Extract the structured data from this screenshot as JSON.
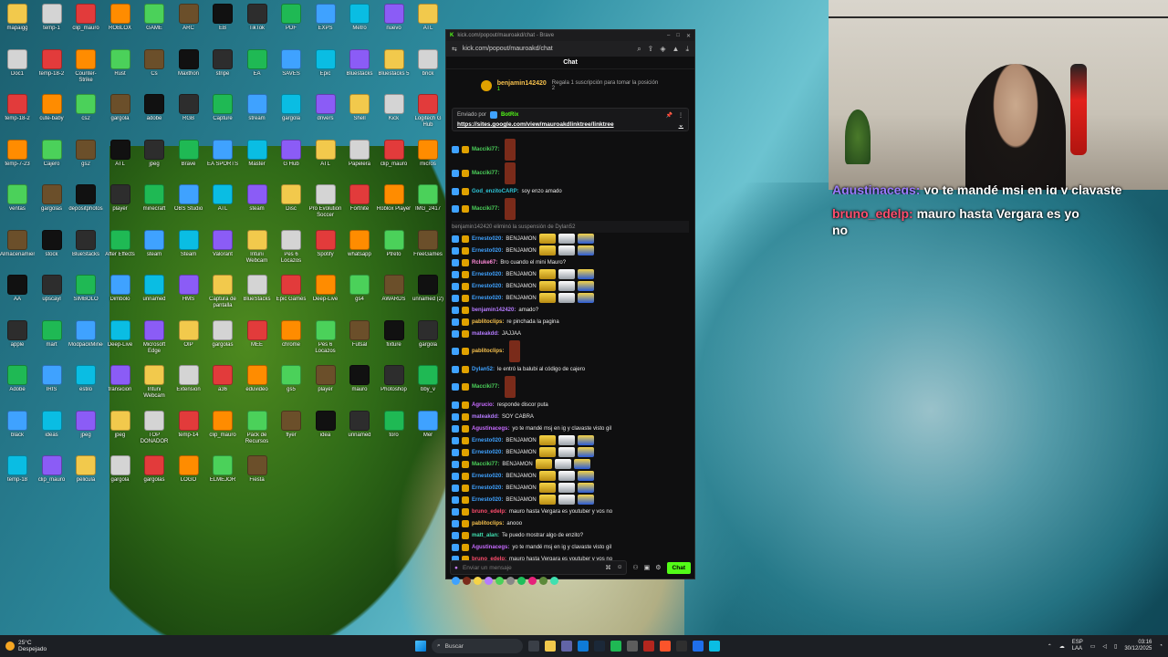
{
  "browser": {
    "title_url": "kick.com/popout/mauroakd/chat - Brave",
    "url": "kick.com/popout/mauroakd/chat"
  },
  "chat": {
    "header": "Chat",
    "top_supporter": {
      "name": "benjamin142420",
      "count": "1",
      "note": "Regala 1 suscripción para tomar la posición 2"
    },
    "pinned": {
      "label": "Enviado por",
      "sender": "BotRix",
      "link": "https://sites.google.com/view/mauroakdlinktree/linktree"
    },
    "messages": [
      {
        "user": "Macciki77:",
        "color": "#4bd15a",
        "text": "",
        "emotes": [
          "tall"
        ],
        "tall": true
      },
      {
        "user": "Macciki77:",
        "color": "#4bd15a",
        "text": "",
        "emotes": [
          "tall"
        ],
        "tall": true
      },
      {
        "user": "God_enzitoCARP:",
        "color": "#2ec4d6",
        "text": "soy enzo amado",
        "emotes": []
      },
      {
        "user": "Macciki77:",
        "color": "#4bd15a",
        "text": "",
        "emotes": [
          "tall"
        ],
        "tall": true
      },
      {
        "user": "",
        "color": "#8c8c8c",
        "text": "benjamin142420 eliminó la suspensión de Dylan52",
        "emotes": [],
        "system": true
      },
      {
        "user": "Ernesto020:",
        "color": "#3fa2ff",
        "text": "BENJAMON",
        "emotes": [
          "y",
          "w",
          "b"
        ]
      },
      {
        "user": "Ernesto020:",
        "color": "#3fa2ff",
        "text": "BENJAMON",
        "emotes": [
          "y",
          "w",
          "b"
        ]
      },
      {
        "user": "Rcluke67:",
        "color": "#ff8ad8",
        "text": "Bro cuando el mini Mauro?",
        "emotes": []
      },
      {
        "user": "Ernesto020:",
        "color": "#3fa2ff",
        "text": "BENJAMON",
        "emotes": [
          "y",
          "w",
          "b"
        ]
      },
      {
        "user": "Ernesto020:",
        "color": "#3fa2ff",
        "text": "BENJAMON",
        "emotes": [
          "y",
          "w",
          "b"
        ]
      },
      {
        "user": "Ernesto020:",
        "color": "#3fa2ff",
        "text": "BENJAMON",
        "emotes": [
          "y",
          "w",
          "b"
        ]
      },
      {
        "user": "benjamin142420:",
        "color": "#b57bff",
        "text": "amado?",
        "emotes": []
      },
      {
        "user": "pablitoclips:",
        "color": "#f7c14d",
        "text": "re pinchada la pagina",
        "emotes": []
      },
      {
        "user": "mateakdd:",
        "color": "#b57bff",
        "text": "JAJJAA",
        "emotes": []
      },
      {
        "user": "pablitoclips:",
        "color": "#f7c14d",
        "text": "",
        "emotes": [
          "tall"
        ],
        "tall": true
      },
      {
        "user": "Dylan52:",
        "color": "#3fa2ff",
        "text": "le entró la balubi al código de cajero",
        "emotes": []
      },
      {
        "user": "Macciki77:",
        "color": "#4bd15a",
        "text": "",
        "emotes": [
          "tall"
        ],
        "tall": true
      },
      {
        "user": "Agrucio:",
        "color": "#c76bff",
        "text": "responde discor puta",
        "emotes": []
      },
      {
        "user": "mateakdd:",
        "color": "#b57bff",
        "text": "SOY CABRA",
        "emotes": []
      },
      {
        "user": "Agustinacegs:",
        "color": "#c76bff",
        "text": "yo te mandé msj en ig y clavaste visto gil",
        "emotes": []
      },
      {
        "user": "Ernesto020:",
        "color": "#3fa2ff",
        "text": "BENJAMON",
        "emotes": [
          "y",
          "w",
          "b"
        ]
      },
      {
        "user": "Ernesto020:",
        "color": "#3fa2ff",
        "text": "BENJAMON",
        "emotes": [
          "y",
          "w",
          "b"
        ]
      },
      {
        "user": "Macciki77:",
        "color": "#4bd15a",
        "text": "BENJAMON",
        "emotes": [
          "y",
          "w",
          "b"
        ]
      },
      {
        "user": "Ernesto020:",
        "color": "#3fa2ff",
        "text": "BENJAMON",
        "emotes": [
          "y",
          "w",
          "b"
        ]
      },
      {
        "user": "Ernesto020:",
        "color": "#3fa2ff",
        "text": "BENJAMON",
        "emotes": [
          "y",
          "w",
          "b"
        ]
      },
      {
        "user": "Ernesto020:",
        "color": "#3fa2ff",
        "text": "BENJAMON",
        "emotes": [
          "y",
          "w",
          "b"
        ]
      },
      {
        "user": "bruno_edelp:",
        "color": "#ff4d6d",
        "text": "mauro hasta Vergara es youtuber y vos no",
        "emotes": []
      },
      {
        "user": "pablitoclips:",
        "color": "#f7c14d",
        "text": "anooo",
        "emotes": []
      },
      {
        "user": "matt_alan:",
        "color": "#3fe0b0",
        "text": "Te puedo mostrar algo de enzito?",
        "emotes": []
      },
      {
        "user": "Agustinacegs:",
        "color": "#c76bff",
        "text": "yo te mandé msj en ig y clavaste visto gil",
        "emotes": []
      },
      {
        "user": "bruno_edelp:",
        "color": "#ff4d6d",
        "text": "mauro hasta Vergara es youtuber y vos no",
        "emotes": []
      }
    ],
    "composer": {
      "placeholder": "Enviar un mensaje",
      "send_label": "Chat"
    }
  },
  "overlay": {
    "line1_user": "Agustinacegs:",
    "line1_text": "yo te mandé msj en ig y clavaste",
    "line2_user": "bruno_edelp:",
    "line2_text": "mauro hasta Vergara es yo",
    "line3_text": "no"
  },
  "desktop_icons": [
    "mapaigg",
    "temp-1",
    "clip_mauro",
    "ROBLOX",
    "GAME",
    "ARC",
    "EB",
    "TikTok",
    "PDF",
    "EXPS",
    "Metro",
    "nuevo",
    "ATL",
    "Doc1",
    "temp-18-2",
    "Counter-Strike",
    "Rust",
    "Cs",
    "Maxthon",
    "stripe",
    "EA",
    "SAVES",
    "Epic",
    "Bluestacks",
    "Bluestacks 5",
    "brick",
    "temp-18-2",
    "cute-baby",
    "cs2",
    "gargola",
    "adobe",
    "RGB",
    "Capture",
    "stream",
    "gargola",
    "drivers",
    "Shell",
    "Kick",
    "Logitech G Hub",
    "temp-7-23",
    "Cajero",
    "gs2",
    "ATL",
    "jpeg",
    "Brave",
    "EA SPORTS",
    "Master",
    "G Hub",
    "ATL",
    "Papelera",
    "clip_mauro",
    "micros",
    "ventas",
    "gargolas",
    "depositphotos",
    "player",
    "minecraft",
    "OBS Studio",
    "ATL",
    "steam",
    "Disc",
    "Pro Evolution Soccer",
    "Fortnite",
    "Roblox Player",
    "IMG_2417",
    "Almacenamiento",
    "stock",
    "BlueStacks",
    "After Effects",
    "steam",
    "Steam",
    "Valorant",
    "Intuni Webcam",
    "Pes 6 Locazos",
    "Spotify",
    "whatsapp",
    "Ptreto",
    "FreeGames",
    "AA",
    "upscayl",
    "SIMBOLO",
    "Dimbolo",
    "unnamed",
    "HMS",
    "Captura de pantalla",
    "BlueStacks",
    "Epic Games",
    "Deep-Live",
    "gs4",
    "AWARDS",
    "unnamed (2)",
    "apple",
    "mart",
    "ModpackMinecraft",
    "Deep-Live",
    "Microsoft Edge",
    "OIP",
    "gargolas",
    "MEE",
    "chrome",
    "Pes 6 Locazos",
    "Futsal",
    "fixture",
    "gargola",
    "Adobe",
    "IRIS",
    "estilo",
    "transicion",
    "Intuni Webcam",
    "Extension",
    "a36",
    "eduvideo",
    "gs5",
    "player",
    "mauro",
    "Photoshop",
    "bby_v",
    "black",
    "ideas",
    "jpeg",
    "jpeg",
    "TOP DONADOR",
    "temp-14",
    "clip_mauro",
    "Pack de Recursos",
    "flyer",
    "idea",
    "unnamed",
    "toro",
    "Mer",
    "temp-18",
    "clip_mauro",
    "pelicula",
    "gargola",
    "gargolas",
    "LOGO",
    "ELMEJOR",
    "Fiesta"
  ],
  "taskbar": {
    "weather_temp": "25°C",
    "weather_desc": "Despejado",
    "search": "Buscar",
    "lang1": "ESP",
    "lang2": "LAA",
    "time": "03:16",
    "date": "30/12/2025"
  },
  "colors": {
    "kick_green": "#53fc18",
    "chat_bg": "#0f0f10"
  }
}
